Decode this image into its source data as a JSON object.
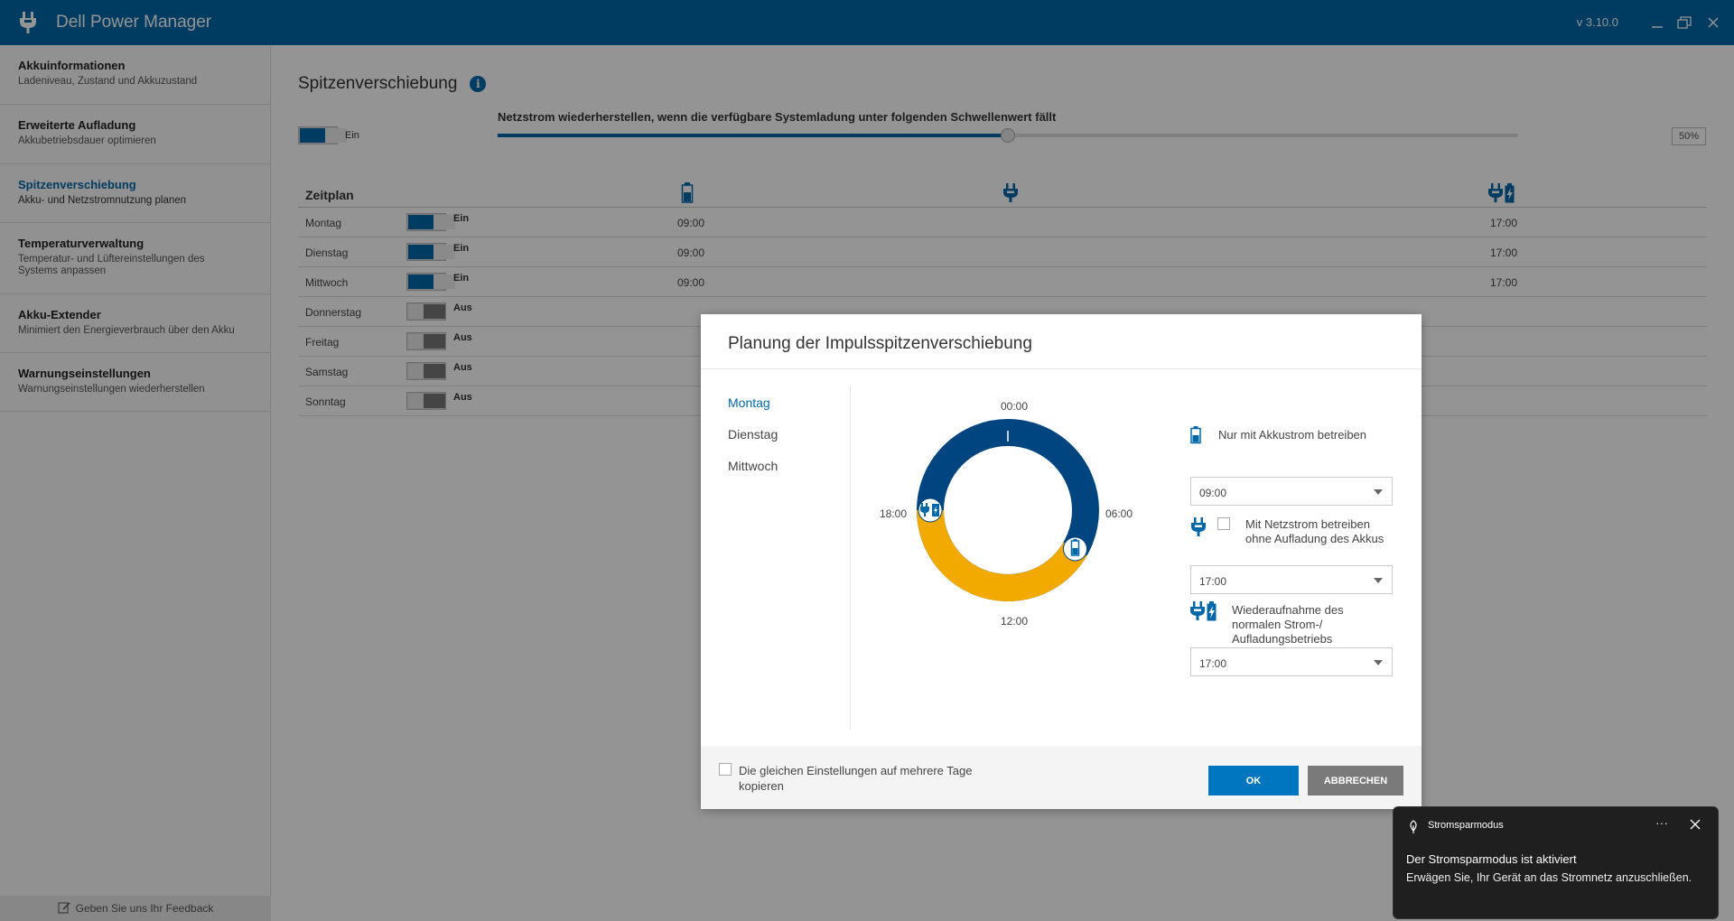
{
  "app": {
    "title": "Dell Power Manager",
    "version": "v 3.10.0"
  },
  "sidebar": {
    "items": [
      {
        "title": "Akkuinformationen",
        "subtitle": "Ladeniveau, Zustand und Akkuzustand"
      },
      {
        "title": "Erweiterte Aufladung",
        "subtitle": "Akkubetriebsdauer optimieren"
      },
      {
        "title": "Spitzenverschiebung",
        "subtitle": "Akku- und Netzstromnutzung planen"
      },
      {
        "title": "Temperaturverwaltung",
        "subtitle": "Temperatur- und Lüftereinstellungen des Systems anpassen"
      },
      {
        "title": "Akku-Extender",
        "subtitle": "Minimiert den Energieverbrauch über den Akku"
      },
      {
        "title": "Warnungseinstellungen",
        "subtitle": "Warnungseinstellungen wiederherstellen"
      }
    ],
    "active_index": 2,
    "feedback": "Geben Sie uns Ihr Feedback"
  },
  "main": {
    "title": "Spitzenverschiebung",
    "toggle_label": "Ein",
    "threshold_label": "Netzstrom wiederherstellen, wenn die verfügbare Systemladung unter folgenden Schwellenwert fällt",
    "threshold_value": "50%",
    "threshold_fraction": 0.5,
    "schedule_label": "Zeitplan",
    "schedule": [
      {
        "day": "Montag",
        "state": "Ein",
        "on": true,
        "battery": "09:00",
        "restore": "17:00"
      },
      {
        "day": "Dienstag",
        "state": "Ein",
        "on": true,
        "battery": "09:00",
        "restore": "17:00"
      },
      {
        "day": "Mittwoch",
        "state": "Ein",
        "on": true,
        "battery": "09:00",
        "restore": "17:00"
      },
      {
        "day": "Donnerstag",
        "state": "Aus",
        "on": false,
        "battery": "",
        "restore": ""
      },
      {
        "day": "Freitag",
        "state": "Aus",
        "on": false,
        "battery": "",
        "restore": ""
      },
      {
        "day": "Samstag",
        "state": "Aus",
        "on": false,
        "battery": "",
        "restore": ""
      },
      {
        "day": "Sonntag",
        "state": "Aus",
        "on": false,
        "battery": "",
        "restore": ""
      }
    ]
  },
  "dialog": {
    "title": "Planung der Impulsspitzenverschiebung",
    "days": [
      "Montag",
      "Dienstag",
      "Mittwoch"
    ],
    "active_day": 0,
    "clock": {
      "top": "00:00",
      "right": "06:00",
      "bottom": "12:00",
      "left": "18:00"
    },
    "option1": {
      "label": "Nur mit Akkustrom betreiben",
      "value": "09:00"
    },
    "option2": {
      "label": "Mit Netzstrom betreiben ohne Aufladung des Akkus",
      "value": "17:00"
    },
    "option3": {
      "label": "Wiederaufnahme des normalen Strom-/ Aufladungsbetriebs",
      "value": "17:00"
    },
    "copy_label": "Die gleichen Einstellungen auf mehrere Tage kopieren",
    "ok": "OK",
    "cancel": "ABBRECHEN"
  },
  "toast": {
    "app": "Stromsparmodus",
    "title": "Der Stromsparmodus ist aktiviert",
    "body": "Erwägen Sie, Ihr Gerät an das Stromnetz anzuschließen."
  },
  "colors": {
    "accent": "#0068a8",
    "ring_blue": "#00457f",
    "ring_orange": "#f2a900"
  }
}
